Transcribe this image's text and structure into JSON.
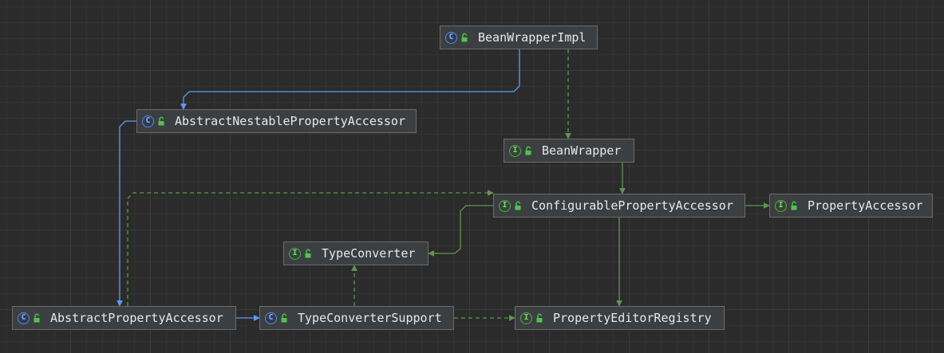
{
  "colors": {
    "background": "#2b2b2b",
    "node_fill": "#3c3f41",
    "node_border": "#6b6b6b",
    "extends_edge": "#5b9cf5",
    "implements_edge": "#5f9650",
    "class_icon": "#5f8ad8",
    "interface_icon": "#5fa05a",
    "public_lock": "#4fc54f"
  },
  "icon_letters": {
    "class": "C",
    "interface": "I"
  },
  "nodes": [
    {
      "id": "beanwrapperimpl",
      "label": "BeanWrapperImpl",
      "kind": "class",
      "icon": "class-icon"
    },
    {
      "id": "abstractnestable",
      "label": "AbstractNestablePropertyAccessor",
      "kind": "class",
      "icon": "class-icon"
    },
    {
      "id": "beanwrapper",
      "label": "BeanWrapper",
      "kind": "interface",
      "icon": "interface-icon"
    },
    {
      "id": "configurable",
      "label": "ConfigurablePropertyAccessor",
      "kind": "interface",
      "icon": "interface-icon"
    },
    {
      "id": "propertyaccessor",
      "label": "PropertyAccessor",
      "kind": "interface",
      "icon": "interface-icon"
    },
    {
      "id": "typeconverter",
      "label": "TypeConverter",
      "kind": "interface",
      "icon": "interface-icon"
    },
    {
      "id": "abstractproperty",
      "label": "AbstractPropertyAccessor",
      "kind": "class",
      "icon": "class-icon"
    },
    {
      "id": "typeconvertersupport",
      "label": "TypeConverterSupport",
      "kind": "class",
      "icon": "class-icon"
    },
    {
      "id": "propertyeditorregistry",
      "label": "PropertyEditorRegistry",
      "kind": "interface",
      "icon": "interface-icon"
    }
  ],
  "edges": [
    {
      "from": "beanwrapperimpl",
      "to": "abstractnestable",
      "relation": "extends"
    },
    {
      "from": "beanwrapperimpl",
      "to": "beanwrapper",
      "relation": "implements"
    },
    {
      "from": "abstractnestable",
      "to": "abstractproperty",
      "relation": "extends"
    },
    {
      "from": "beanwrapper",
      "to": "configurable",
      "relation": "extends"
    },
    {
      "from": "abstractproperty",
      "to": "configurable",
      "relation": "implements"
    },
    {
      "from": "configurable",
      "to": "propertyaccessor",
      "relation": "extends"
    },
    {
      "from": "configurable",
      "to": "typeconverter",
      "relation": "extends"
    },
    {
      "from": "configurable",
      "to": "propertyeditorregistry",
      "relation": "extends"
    },
    {
      "from": "abstractproperty",
      "to": "typeconvertersupport",
      "relation": "extends"
    },
    {
      "from": "typeconvertersupport",
      "to": "typeconverter",
      "relation": "implements"
    },
    {
      "from": "typeconvertersupport",
      "to": "propertyeditorregistry",
      "relation": "implements"
    }
  ]
}
